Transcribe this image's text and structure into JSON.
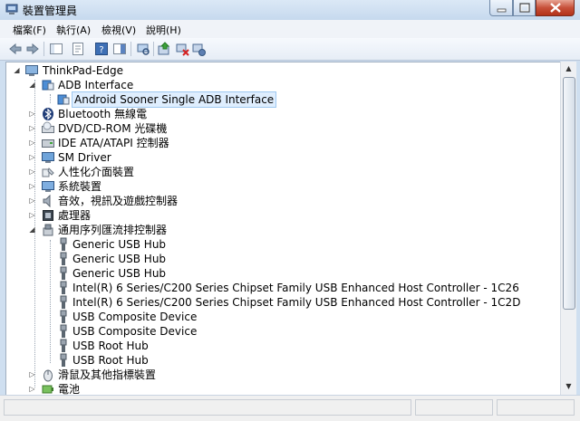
{
  "window": {
    "title": "裝置管理員"
  },
  "menu": {
    "items": [
      "檔案(F)",
      "執行(A)",
      "檢視(V)",
      "說明(H)"
    ]
  },
  "toolbar": {
    "buttons": [
      "back-icon",
      "forward-icon",
      "show-hide-console-tree-icon",
      "properties-icon",
      "help-icon",
      "action-pane-icon",
      "scan-hardware-icon",
      "update-driver-icon",
      "disable-device-icon",
      "uninstall-device-icon"
    ]
  },
  "tree": {
    "root": "ThinkPad-Edge",
    "adb_category": "ADB Interface",
    "adb_device": "Android Sooner Single ADB Interface",
    "categories": {
      "bluetooth": "Bluetooth 無線電",
      "dvd": "DVD/CD-ROM 光碟機",
      "ide": "IDE ATA/ATAPI 控制器",
      "sm": "SM Driver",
      "hid": "人性化介面裝置",
      "system": "系統裝置",
      "sound": "音效，視訊及遊戲控制器",
      "processor": "處理器",
      "usb": "通用序列匯流排控制器",
      "mouse": "滑鼠及其他指標裝置",
      "battery": "電池"
    },
    "usb_devices": [
      "Generic USB Hub",
      "Generic USB Hub",
      "Generic USB Hub",
      "Intel(R) 6 Series/C200 Series Chipset Family USB Enhanced Host Controller - 1C26",
      "Intel(R) 6 Series/C200 Series Chipset Family USB Enhanced Host Controller - 1C2D",
      "USB Composite Device",
      "USB Composite Device",
      "USB Root Hub",
      "USB Root Hub"
    ]
  },
  "colors": {
    "selection_bg": "#dfeefe",
    "selection_border": "#9ec8f0",
    "titlebar": "#c6d9ee"
  }
}
